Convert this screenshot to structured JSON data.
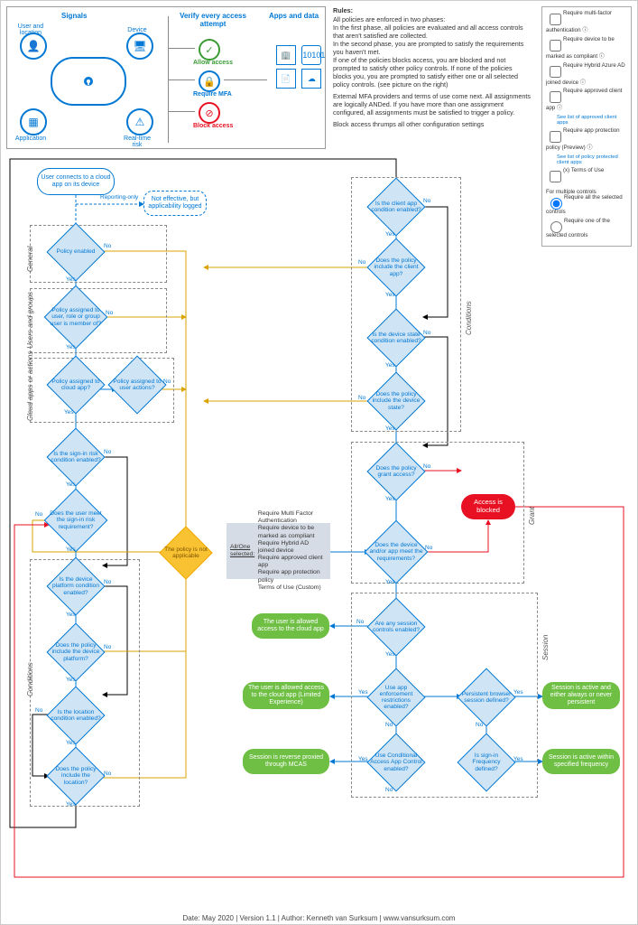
{
  "header": {
    "signals": "Signals",
    "verify": "Verify every access attempt",
    "apps": "Apps and data",
    "userloc": "User and location",
    "device": "Device",
    "application": "Application",
    "realtime": "Real-time risk",
    "allow": "Allow access",
    "mfa": "Require MFA",
    "block": "Block access"
  },
  "rules": {
    "title": "Rules:",
    "p1": "All policies are enforced in two phases:",
    "p2": "In the first phase, all policies are evaluated and all access controls that aren't satisfied are collected.",
    "p3": "In the second phase, you are prompted to satisfy the requirements you haven't met.",
    "p4": "If one of the policies blocks access, you are blocked and not prompted to satisfy other policy controls. If none of the policies blocks you, you are prompted to satisfy either one or all selected policy controls. (see picture on the right)",
    "p5": "External MFA providers and terms of use come next. All assignments are logically ANDed. If you have more than one assignment configured, all assignments must be satisfied to trigger a policy.",
    "p6": "Block access thrumps all other configuration settings"
  },
  "controls": {
    "c1": "Require multi-factor authentication ⓘ",
    "c2": "Require device to be marked as compliant ⓘ",
    "c3": "Require Hybrid Azure AD joined device ⓘ",
    "c4": "Require approved client app ⓘ",
    "l4": "See list of approved client apps",
    "c5": "Require app protection policy (Preview) ⓘ",
    "l5": "See list of policy protected client apps",
    "c6": "(x) Terms of Use",
    "multi": "For multiple controls",
    "r1": "Require all the selected controls",
    "r2": "Require one of the selected controls"
  },
  "flow": {
    "start": "User connects to a cloud app on its device",
    "log": "Not effective, but applicability logged",
    "pe": "Policy enabled",
    "ua": "Policy assigned to user, role or group user is member of?",
    "ca": "Policy assigned to cloud app?",
    "uact": "Policy assigned to user actions?",
    "sr": "Is the sign-in risk condition enabled?",
    "srm": "Does the user meet the sign-in risk requirement?",
    "dpc": "Is the device platform condition enabled?",
    "dpi": "Does the policy include the device platform?",
    "lc": "Is the location condition enabled?",
    "li": "Does the policy include the location?",
    "cac": "Is the client app condition enabled?",
    "cai": "Does the policy include the client app?",
    "dsc": "Is the device state condition enabled?",
    "dsi": "Does the policy include the device state?",
    "ga": "Does the policy grant access?",
    "mr": "Does the device and/or app meet the requirements?",
    "na": "The policy is not applicable",
    "blk": "Access is blocked",
    "note_t": "All/One selected:",
    "note": "Require Multi Factor Authentication\nRequire device to be marked as compliant\nRequire Hybrid AD joined device\nRequire approved client app\nRequire app protection policy\nTerms of Use (Custom)",
    "asc": "Are any session controls enabled?",
    "aer": "Use app enforcement restrictions enabled?",
    "cacc": "Use Conditional Access App Control enabled?",
    "pbs": "Persistent browser session defined?",
    "sif": "Is sign-in Frequency defined?",
    "g1": "The user is allowed access to the cloud app",
    "g2": "The user is allowed access to the cloud app (Limited Experience)",
    "g3": "Session is reverse proxied through MCAS",
    "g4": "Session is active and either always or never persistent",
    "g5": "Session is active within specified frequency",
    "yes": "Yes",
    "no": "No",
    "ro": "Reporting-only"
  },
  "sections": {
    "gen": "General",
    "ug": "Users and groups",
    "caa": "Cloud apps or actions",
    "cond": "Conditions",
    "cond2": "Conditions",
    "grant": "Grant",
    "sess": "Session"
  },
  "footer": "Date: May 2020 | Version 1.1 | Author: Kenneth van Surksum | www.vansurksum.com"
}
